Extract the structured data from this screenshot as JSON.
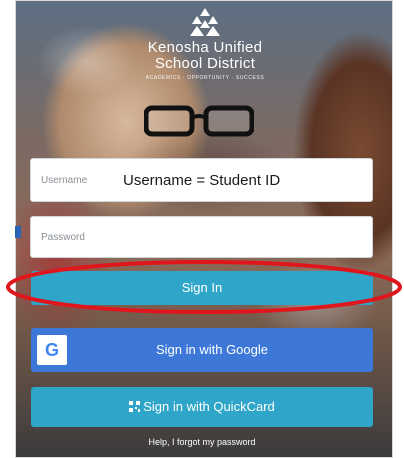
{
  "logo": {
    "line1": "Kenosha Unified",
    "line2": "School District",
    "tagline": "ACADEMICS · OPPORTUNITY · SUCCESS"
  },
  "login": {
    "username_label": "Username",
    "username_value": "Username = Student ID",
    "password_label": "Password",
    "signin_button": "Sign In",
    "google_button": "Sign in with Google",
    "google_letter": "G",
    "quickcard_button": "Sign in with QuickCard",
    "help_link": "Help, I forgot my password"
  },
  "colors": {
    "signin": "#2fa5c9",
    "google": "#3d78d8",
    "annotation": "#e0161d"
  }
}
